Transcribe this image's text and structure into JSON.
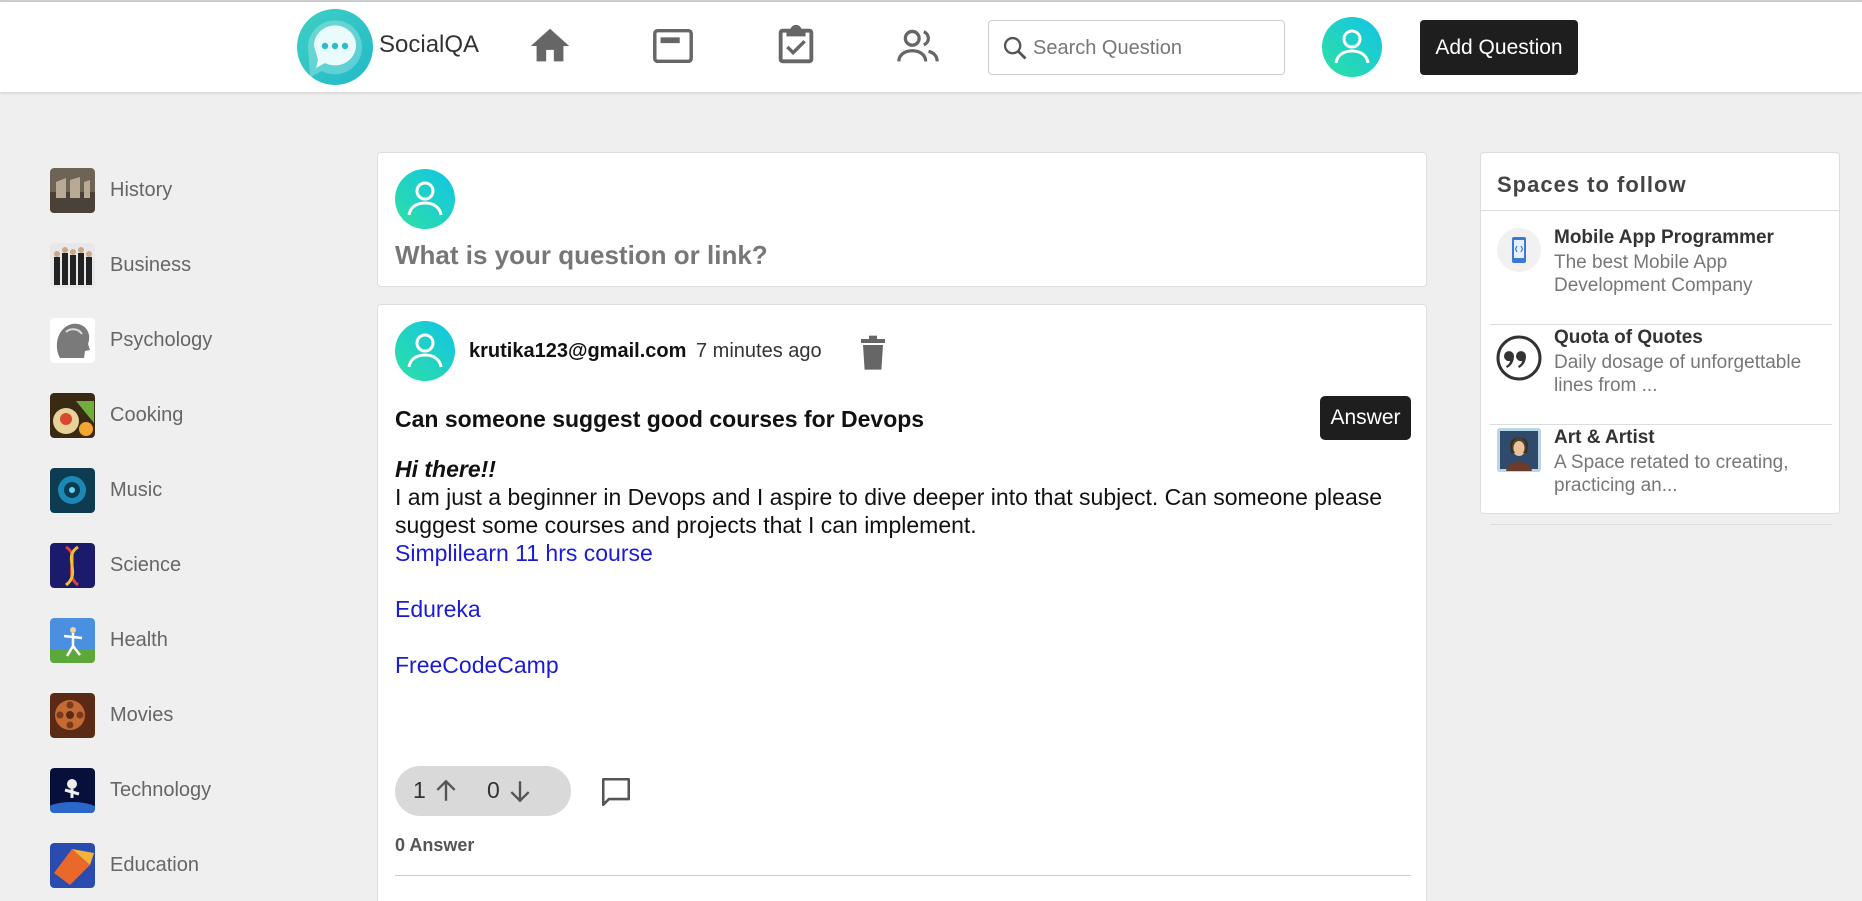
{
  "header": {
    "brand": "SocialQA",
    "nav_icons": [
      "home-icon",
      "news-feed-icon",
      "assignment-check-icon",
      "people-icon"
    ],
    "search": {
      "placeholder": "Search Question",
      "value": ""
    },
    "add_question_label": "Add Question"
  },
  "sidebar": {
    "items": [
      {
        "label": "History",
        "thumb": "history-thumbnail"
      },
      {
        "label": "Business",
        "thumb": "business-thumbnail"
      },
      {
        "label": "Psychology",
        "thumb": "psychology-thumbnail"
      },
      {
        "label": "Cooking",
        "thumb": "cooking-thumbnail"
      },
      {
        "label": "Music",
        "thumb": "music-thumbnail"
      },
      {
        "label": "Science",
        "thumb": "science-thumbnail"
      },
      {
        "label": "Health",
        "thumb": "health-thumbnail"
      },
      {
        "label": "Movies",
        "thumb": "movies-thumbnail"
      },
      {
        "label": "Technology",
        "thumb": "technology-thumbnail"
      },
      {
        "label": "Education",
        "thumb": "education-thumbnail"
      }
    ]
  },
  "ask_box": {
    "prompt": "What is your question or link?"
  },
  "post": {
    "user": "krutika123@gmail.com",
    "time": "7 minutes ago",
    "title": "Can someone suggest good courses for Devops",
    "answer_button": "Answer",
    "greeting": "Hi there!!",
    "body": "I am just a beginner in Devops and I aspire to dive deeper into that subject. Can someone please suggest some courses and projects that I can implement.",
    "links": [
      "Simplilearn 11 hrs course",
      "Edureka",
      "FreeCodeCamp"
    ],
    "upvotes": "1",
    "downvotes": "0",
    "answer_count": "0 Answer"
  },
  "spaces": {
    "title": "Spaces to follow",
    "items": [
      {
        "name": "Mobile App Programmer",
        "desc": "The best Mobile App Development Company",
        "icon": "mobile-app-icon"
      },
      {
        "name": "Quota of Quotes",
        "desc": "Daily dosage of unforgettable lines from ...",
        "icon": "quote-icon"
      },
      {
        "name": "Art & Artist",
        "desc": "A Space retated to creating, practicing an...",
        "icon": "portrait-painting-icon"
      }
    ]
  },
  "colors": {
    "accent_gradient_start": "#2ed6b0",
    "accent_gradient_end": "#13c6e0",
    "dark_button": "#1e1e1e",
    "link": "#1a1ad8",
    "page_background": "#efefef"
  }
}
